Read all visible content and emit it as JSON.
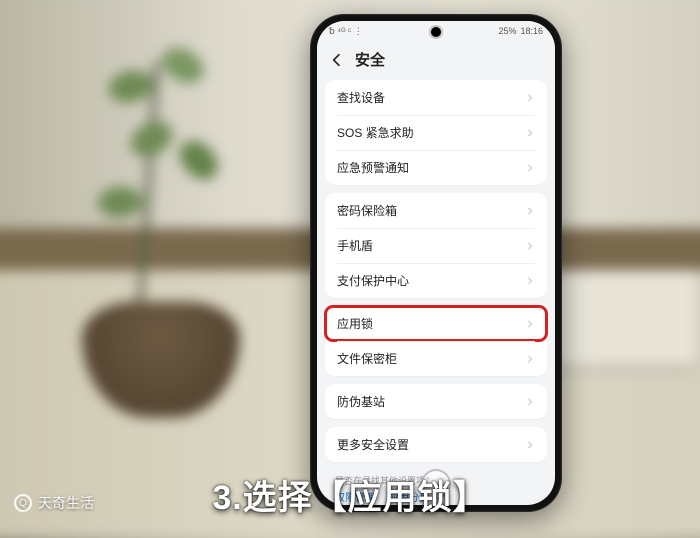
{
  "status": {
    "left": "␢ ⁴ᴳ ᶜ ⋮",
    "battery": "25%",
    "time": "18:16"
  },
  "header": {
    "title": "安全"
  },
  "groups": [
    {
      "rows": [
        {
          "label": "查找设备",
          "name": "row-find-device"
        },
        {
          "label": "SOS 紧急求助",
          "name": "row-sos"
        },
        {
          "label": "应急预警通知",
          "name": "row-emergency-alert"
        }
      ]
    },
    {
      "rows": [
        {
          "label": "密码保险箱",
          "name": "row-password-vault"
        },
        {
          "label": "手机盾",
          "name": "row-phone-shield"
        },
        {
          "label": "支付保护中心",
          "name": "row-payment-protection"
        }
      ]
    },
    {
      "rows": [
        {
          "label": "应用锁",
          "name": "row-app-lock",
          "highlight": true
        },
        {
          "label": "文件保密柜",
          "name": "row-file-safe"
        }
      ]
    },
    {
      "rows": [
        {
          "label": "防伪基站",
          "name": "row-fake-base-station"
        }
      ]
    },
    {
      "rows": [
        {
          "label": "更多安全设置",
          "name": "row-more-security"
        }
      ]
    }
  ],
  "footer": {
    "question": "是否在寻找其他设置项？",
    "links": [
      "权限管理",
      "应用分身"
    ]
  },
  "caption": "3.选择【应用锁】",
  "watermark": "天奇生活"
}
